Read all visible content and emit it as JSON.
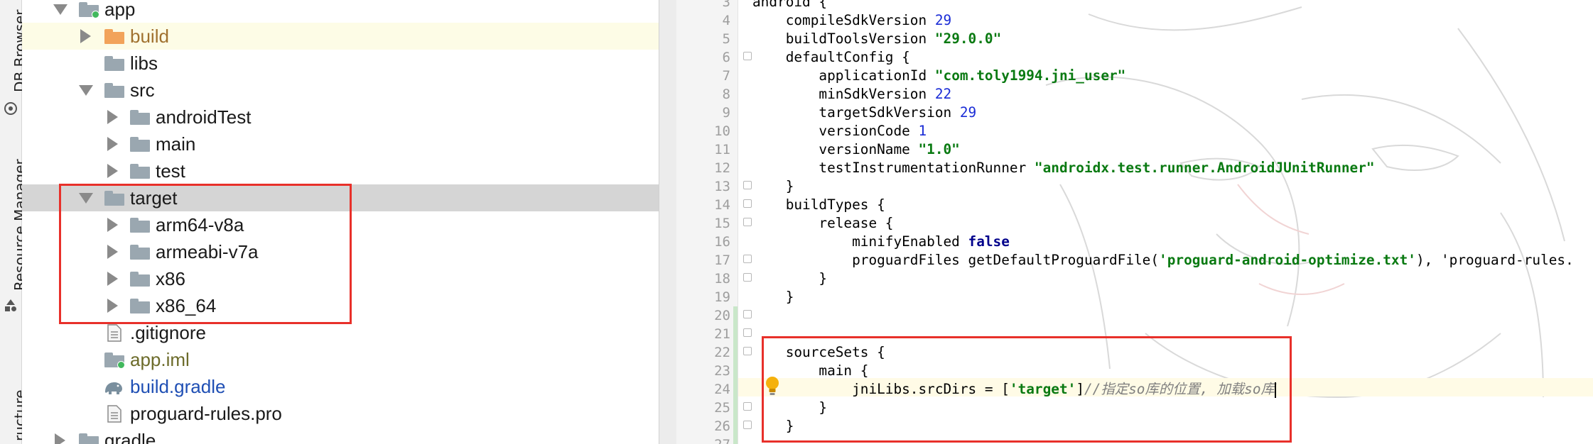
{
  "toolwindows": {
    "db_browser": "DB Browser",
    "resource_manager": "Resource Manager",
    "structure": "ructure"
  },
  "project_tree": {
    "rows": [
      {
        "label": "app",
        "depth": 1,
        "expanded": true,
        "kind": "module"
      },
      {
        "label": "build",
        "depth": 2,
        "expanded": false,
        "kind": "excluded-folder"
      },
      {
        "label": "libs",
        "depth": 2,
        "kind": "folder"
      },
      {
        "label": "src",
        "depth": 2,
        "expanded": true,
        "kind": "folder"
      },
      {
        "label": "androidTest",
        "depth": 3,
        "expanded": false,
        "kind": "folder"
      },
      {
        "label": "main",
        "depth": 3,
        "expanded": false,
        "kind": "folder"
      },
      {
        "label": "test",
        "depth": 3,
        "expanded": false,
        "kind": "folder"
      },
      {
        "label": "target",
        "depth": 2,
        "expanded": true,
        "kind": "folder",
        "selected": true
      },
      {
        "label": "arm64-v8a",
        "depth": 3,
        "expanded": false,
        "kind": "folder"
      },
      {
        "label": "armeabi-v7a",
        "depth": 3,
        "expanded": false,
        "kind": "folder"
      },
      {
        "label": "x86",
        "depth": 3,
        "expanded": false,
        "kind": "folder"
      },
      {
        "label": "x86_64",
        "depth": 3,
        "expanded": false,
        "kind": "folder"
      },
      {
        "label": ".gitignore",
        "depth": 2,
        "kind": "file"
      },
      {
        "label": "app.iml",
        "depth": 2,
        "kind": "iml-file"
      },
      {
        "label": "build.gradle",
        "depth": 2,
        "kind": "gradle-file"
      },
      {
        "label": "proguard-rules.pro",
        "depth": 2,
        "kind": "file"
      },
      {
        "label": "gradle",
        "depth": 1,
        "expanded": false,
        "kind": "folder"
      }
    ]
  },
  "editor": {
    "current_line": 24,
    "lines": [
      {
        "num": "3",
        "text": "android {"
      },
      {
        "num": "4",
        "text": "    compileSdkVersion 29"
      },
      {
        "num": "5",
        "text": "    buildToolsVersion \"29.0.0\""
      },
      {
        "num": "6",
        "text": "    defaultConfig {"
      },
      {
        "num": "7",
        "text": "        applicationId \"com.toly1994.jni_user\""
      },
      {
        "num": "8",
        "text": "        minSdkVersion 22"
      },
      {
        "num": "9",
        "text": "        targetSdkVersion 29"
      },
      {
        "num": "10",
        "text": "        versionCode 1"
      },
      {
        "num": "11",
        "text": "        versionName \"1.0\""
      },
      {
        "num": "12",
        "text": "        testInstrumentationRunner \"androidx.test.runner.AndroidJUnitRunner\""
      },
      {
        "num": "13",
        "text": "    }"
      },
      {
        "num": "14",
        "text": "    buildTypes {"
      },
      {
        "num": "15",
        "text": "        release {"
      },
      {
        "num": "16",
        "text": "            minifyEnabled false"
      },
      {
        "num": "17",
        "text": "            proguardFiles getDefaultProguardFile('proguard-android-optimize.txt'), 'proguard-rules."
      },
      {
        "num": "18",
        "text": "        }"
      },
      {
        "num": "19",
        "text": "    }"
      },
      {
        "num": "20",
        "text": ""
      },
      {
        "num": "21",
        "text": ""
      },
      {
        "num": "22",
        "text": "    sourceSets {"
      },
      {
        "num": "23",
        "text": "        main {"
      },
      {
        "num": "24",
        "text": "            jniLibs.srcDirs = ['target']//指定so库的位置, 加载so库"
      },
      {
        "num": "25",
        "text": "        }"
      },
      {
        "num": "26",
        "text": "    }"
      },
      {
        "num": "27",
        "text": ""
      }
    ]
  },
  "colors": {
    "annotation_box": "#e8302a",
    "string": "#0a7a12",
    "number": "#1a2cd6",
    "keyword": "#00008b",
    "comment": "#808080"
  }
}
